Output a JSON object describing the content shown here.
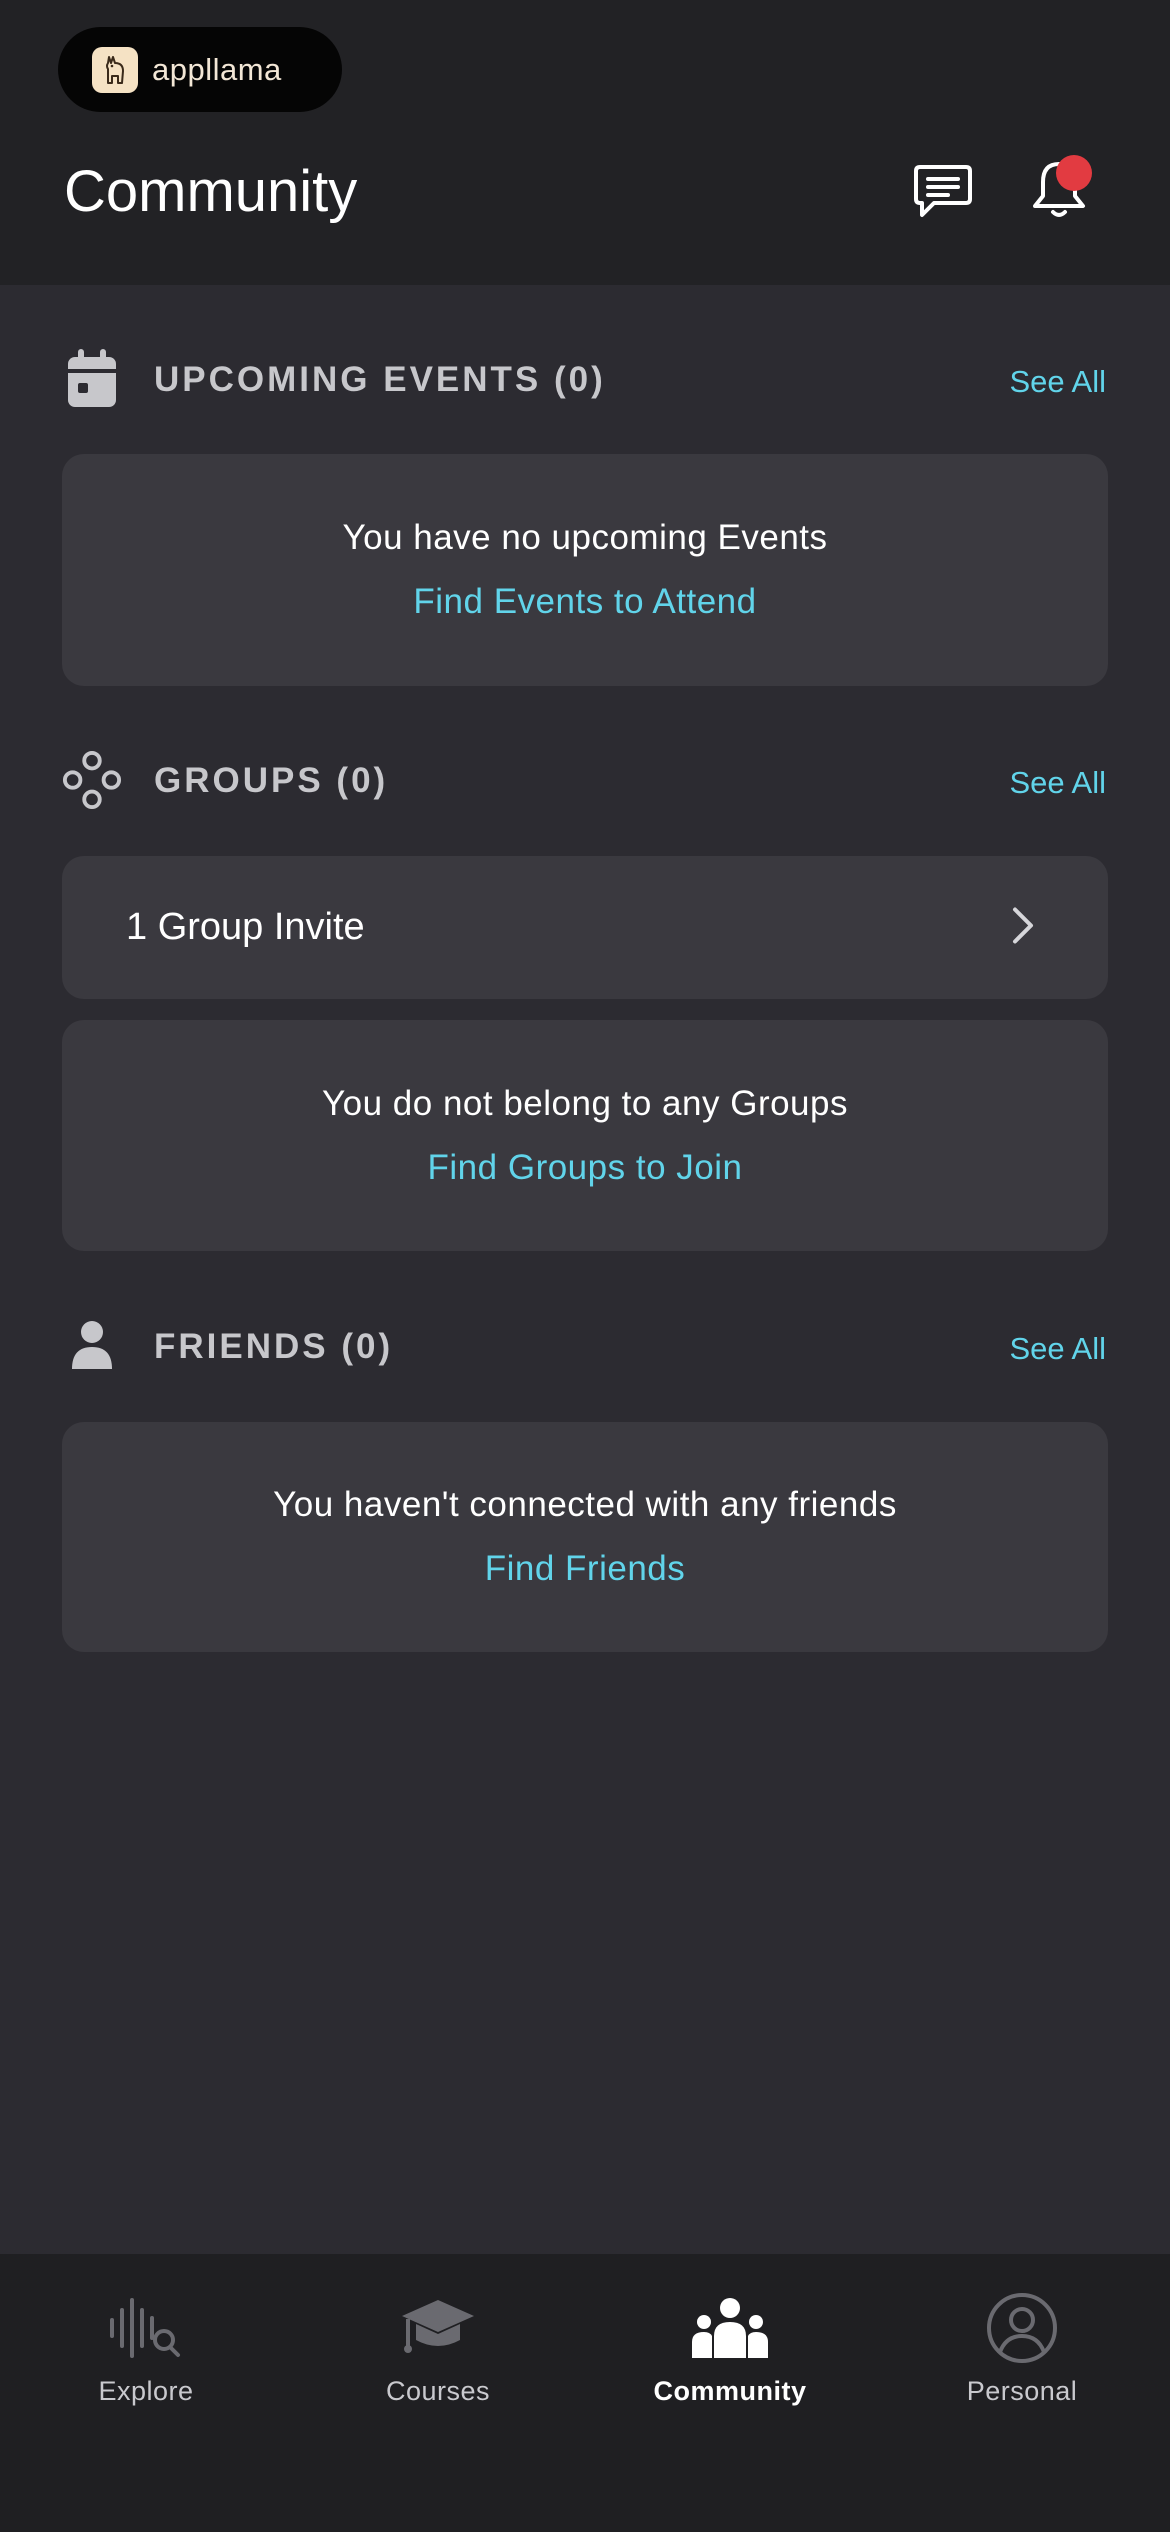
{
  "brand": {
    "name": "appllama"
  },
  "header": {
    "title": "Community",
    "icons": {
      "chat": "chat-icon",
      "bell": "bell-icon"
    },
    "notification_dot_color": "#e23b41"
  },
  "sections": {
    "events": {
      "title": "UPCOMING EVENTS (0)",
      "see_all": "See All",
      "empty_text": "You have no upcoming Events",
      "empty_link": "Find Events to Attend",
      "icon": "calendar-icon"
    },
    "groups": {
      "title": "GROUPS (0)",
      "see_all": "See All",
      "invite_label": "1 Group Invite",
      "empty_text": "You do not belong to any Groups",
      "empty_link": "Find Groups to Join",
      "icon": "groups-icon"
    },
    "friends": {
      "title": "FRIENDS (0)",
      "see_all": "See All",
      "empty_text": "You haven't connected with any friends",
      "empty_link": "Find Friends",
      "icon": "person-icon"
    }
  },
  "tabbar": {
    "tabs": [
      {
        "label": "Explore",
        "icon": "explore-search-icon",
        "active": false
      },
      {
        "label": "Courses",
        "icon": "graduation-cap-icon",
        "active": false
      },
      {
        "label": "Community",
        "icon": "community-people-icon",
        "active": true
      },
      {
        "label": "Personal",
        "icon": "user-circle-icon",
        "active": false
      }
    ]
  },
  "colors": {
    "accent": "#61d4ea",
    "background": "#2c2b31",
    "header": "#222225",
    "card": "#3a393f",
    "tabbar": "#1f1f22"
  }
}
